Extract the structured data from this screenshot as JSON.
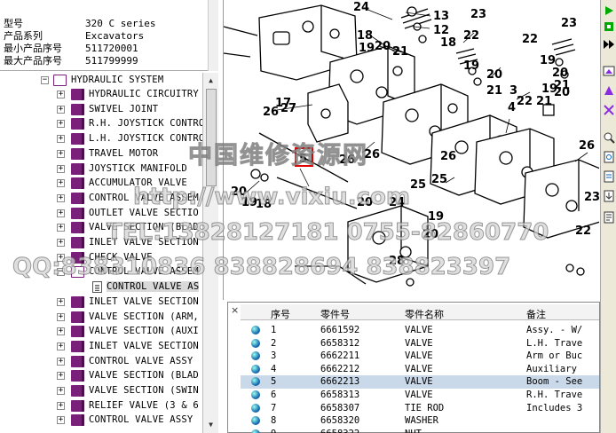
{
  "info": {
    "rows": [
      {
        "key": "型号",
        "value": "320 C series"
      },
      {
        "key": "产品系列",
        "value": "Excavators"
      },
      {
        "key": "最小产品序号",
        "value": "511720001"
      },
      {
        "key": "最大产品序号",
        "value": "511799999"
      }
    ]
  },
  "tree": {
    "root": "HYDRAULIC SYSTEM",
    "items": [
      {
        "label": "HYDRAULIC CIRCUITRY"
      },
      {
        "label": "SWIVEL JOINT"
      },
      {
        "label": "R.H. JOYSTICK CONTRO"
      },
      {
        "label": "L.H. JOYSTICK CONTRO"
      },
      {
        "label": "TRAVEL MOTOR"
      },
      {
        "label": "JOYSTICK MANIFOLD"
      },
      {
        "label": "ACCUMULATOR VALVE"
      },
      {
        "label": "CONTROL VALVE ASSEM"
      },
      {
        "label": "OUTLET VALVE SECTIO"
      },
      {
        "label": "VALVE SECTION (BLAD"
      },
      {
        "label": "INLET VALVE SECTION"
      },
      {
        "label": "CHECK VALVE"
      },
      {
        "label": "CONTROL VALVE ASSEM"
      },
      {
        "label": "CONTROL VALVE AS"
      },
      {
        "label": "INLET VALVE SECTION"
      },
      {
        "label": "VALVE SECTION (ARM,"
      },
      {
        "label": "VALVE SECTION (AUXI"
      },
      {
        "label": "INLET VALVE SECTION"
      },
      {
        "label": "CONTROL VALVE ASSY"
      },
      {
        "label": "VALVE SECTION (BLAD"
      },
      {
        "label": "VALVE SECTION (SWIN"
      },
      {
        "label": "RELIEF VALVE (3 & 6"
      },
      {
        "label": "CONTROL VALVE ASSY"
      }
    ]
  },
  "drawing": {
    "callouts": [
      "24",
      "13",
      "12",
      "18",
      "19",
      "20",
      "21",
      "22",
      "23",
      "17",
      "19",
      "20",
      "21",
      "18",
      "19",
      "20",
      "21",
      "22",
      "23",
      "22",
      "19",
      "20",
      "21",
      "26",
      "27",
      "3",
      "4",
      "5",
      "26",
      "25",
      "26",
      "26",
      "25",
      "20",
      "19",
      "18",
      "20",
      "24",
      "20",
      "19",
      "28",
      "22",
      "23",
      "26"
    ],
    "highlighted_callout": "5"
  },
  "parts": {
    "columns": [
      "序号",
      "零件号",
      "零件名称",
      "备注"
    ],
    "rows": [
      {
        "no": "1",
        "part": "6661592",
        "name": "VALVE",
        "note": "Assy. - W/"
      },
      {
        "no": "2",
        "part": "6658312",
        "name": "VALVE",
        "note": "L.H. Trave"
      },
      {
        "no": "3",
        "part": "6662211",
        "name": "VALVE",
        "note": "Arm or Buc"
      },
      {
        "no": "4",
        "part": "6662212",
        "name": "VALVE",
        "note": "Auxiliary"
      },
      {
        "no": "5",
        "part": "6662213",
        "name": "VALVE",
        "note": "Boom - See"
      },
      {
        "no": "6",
        "part": "6658313",
        "name": "VALVE",
        "note": "R.H. Trave"
      },
      {
        "no": "7",
        "part": "6658307",
        "name": "TIE ROD",
        "note": "Includes 3"
      },
      {
        "no": "8",
        "part": "6658320",
        "name": "WASHER",
        "note": ""
      },
      {
        "no": "9",
        "part": "6658322",
        "name": "NUT",
        "note": ""
      }
    ],
    "selected_row": "5"
  },
  "watermark": {
    "line1": "中国维修资源网",
    "line2": "http://www.vixiu.com",
    "line3": "TEL:13828127181 0755-82860770",
    "line4": "QQ:838310836 838828694 838823397"
  },
  "colors": {
    "book_icon": "#7a1f7a",
    "callout_box": "#e00000",
    "selected_row": "#c9d9ea"
  },
  "toolbar": {
    "icons": [
      "play-icon",
      "stop-icon",
      "next-icon",
      "prev-icon",
      "fullscreen-icon",
      "zoom-in-icon",
      "zoom-out-icon",
      "pan-icon",
      "rotate-icon",
      "print-icon",
      "export-icon"
    ]
  }
}
